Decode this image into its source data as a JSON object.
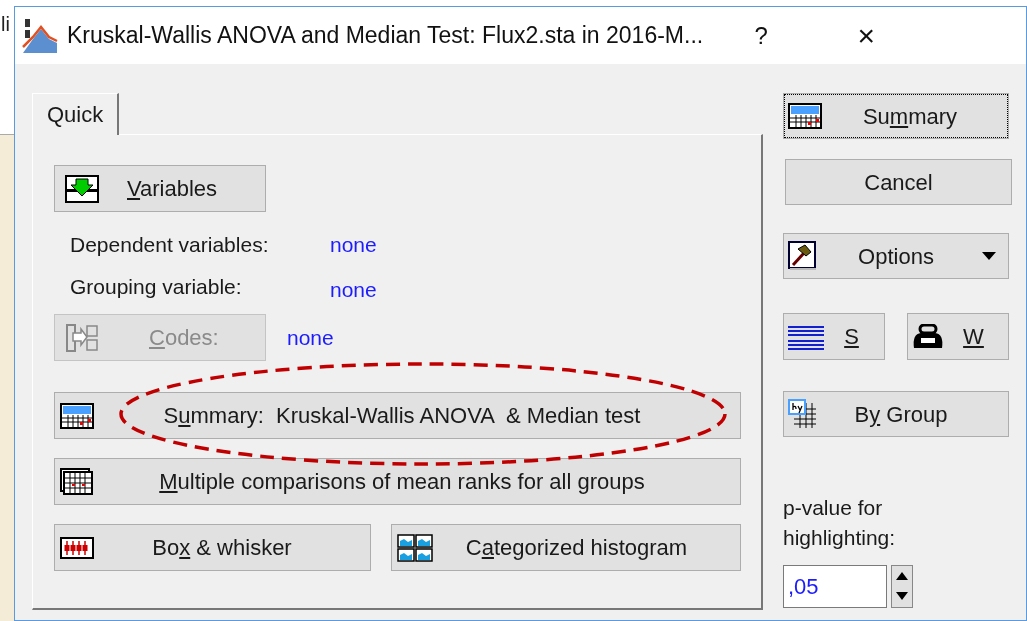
{
  "background_window": {
    "text": "li"
  },
  "window": {
    "title": "Kruskal-Wallis ANOVA and Median Test: Flux2.sta in 2016-M...",
    "help": "?",
    "close": "×"
  },
  "tabs": [
    {
      "label": "Quick",
      "selected": true
    }
  ],
  "quick": {
    "variables_button": {
      "label": {
        "key": "V",
        "after": "ariables"
      }
    },
    "fields": [
      {
        "label": "Dependent variables:",
        "value": "none"
      },
      {
        "label": "Grouping variable:",
        "value": "none"
      }
    ],
    "codes_button": {
      "label": {
        "key": "C",
        "after": "odes:"
      },
      "disabled": true
    },
    "codes_value": "none",
    "buttons": [
      {
        "label": {
          "before": "S",
          "key": "u",
          "after": "mmary:  Kruskal-Wallis ANOVA  & Median test"
        },
        "highlighted": true
      },
      {
        "label": {
          "key": "M",
          "after": "ultiple comparisons of mean ranks for all groups"
        },
        "highlighted": false
      }
    ],
    "bottom_buttons": [
      {
        "label": {
          "before": "Bo",
          "key": "x",
          "after": " & whisker"
        }
      },
      {
        "label": {
          "before": "C",
          "key": "a",
          "after": "tegorized histogram"
        }
      }
    ]
  },
  "side": {
    "buttons": [
      {
        "label": {
          "before": "Su",
          "key": "m",
          "after": "mary"
        },
        "focused": true,
        "dropdown": false
      },
      {
        "label": {
          "before": "Cancel"
        },
        "focused": false,
        "dropdown": false
      },
      {
        "label": {
          "before": "Options"
        },
        "focused": false,
        "dropdown": true
      }
    ],
    "small_buttons": [
      {
        "label": {
          "key": "S"
        }
      },
      {
        "label": {
          "key": "W"
        }
      }
    ],
    "group_button": {
      "label": {
        "before": "B",
        "key": "y",
        "after": " Group"
      }
    },
    "p_value": {
      "label": "p-value for highlighting:",
      "value": ",05"
    }
  }
}
